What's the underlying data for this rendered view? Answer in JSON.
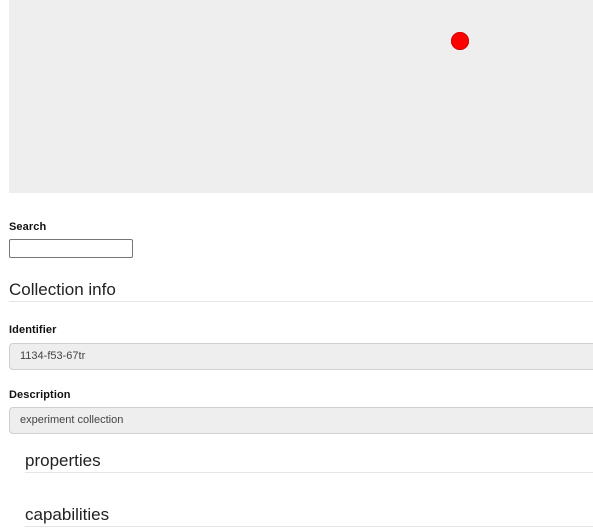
{
  "map": {
    "background_color": "#eeeeee",
    "marker_color": "#ff0000"
  },
  "search": {
    "label": "Search",
    "value": "",
    "placeholder": ""
  },
  "collection_info": {
    "title": "Collection info",
    "identifier_label": "Identifier",
    "identifier_value": "1134-f53-67tr",
    "description_label": "Description",
    "description_value": "experiment collection"
  },
  "sections": {
    "properties_title": "properties",
    "capabilities_title": "capabilities"
  }
}
